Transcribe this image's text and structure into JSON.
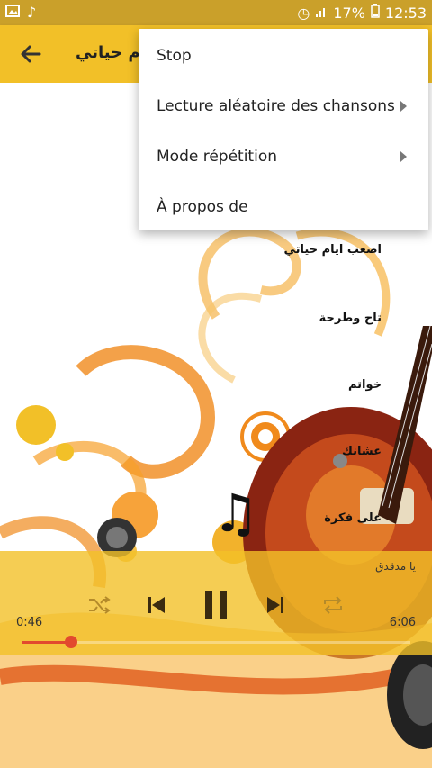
{
  "statusbar": {
    "battery_percent": "17%",
    "time": "12:53"
  },
  "appbar": {
    "title": "ايام حياتي"
  },
  "songs": [
    "اصعب ايام حياتي",
    "تاج وطرحة",
    "خواتم",
    "عشانك",
    "على فكرة"
  ],
  "player": {
    "now_playing": "يا مدقدق",
    "elapsed": "0:46",
    "duration": "6:06",
    "progress": 0.127
  },
  "menu": {
    "items": [
      {
        "label": "Stop"
      },
      {
        "label": "Lecture aléatoire des chansons"
      },
      {
        "label": "Mode répétition"
      },
      {
        "label": "À propos de"
      }
    ]
  },
  "colors": {
    "accent": "#f2c028",
    "statusbar": "#caa02a",
    "progress": "#e24a2e"
  }
}
